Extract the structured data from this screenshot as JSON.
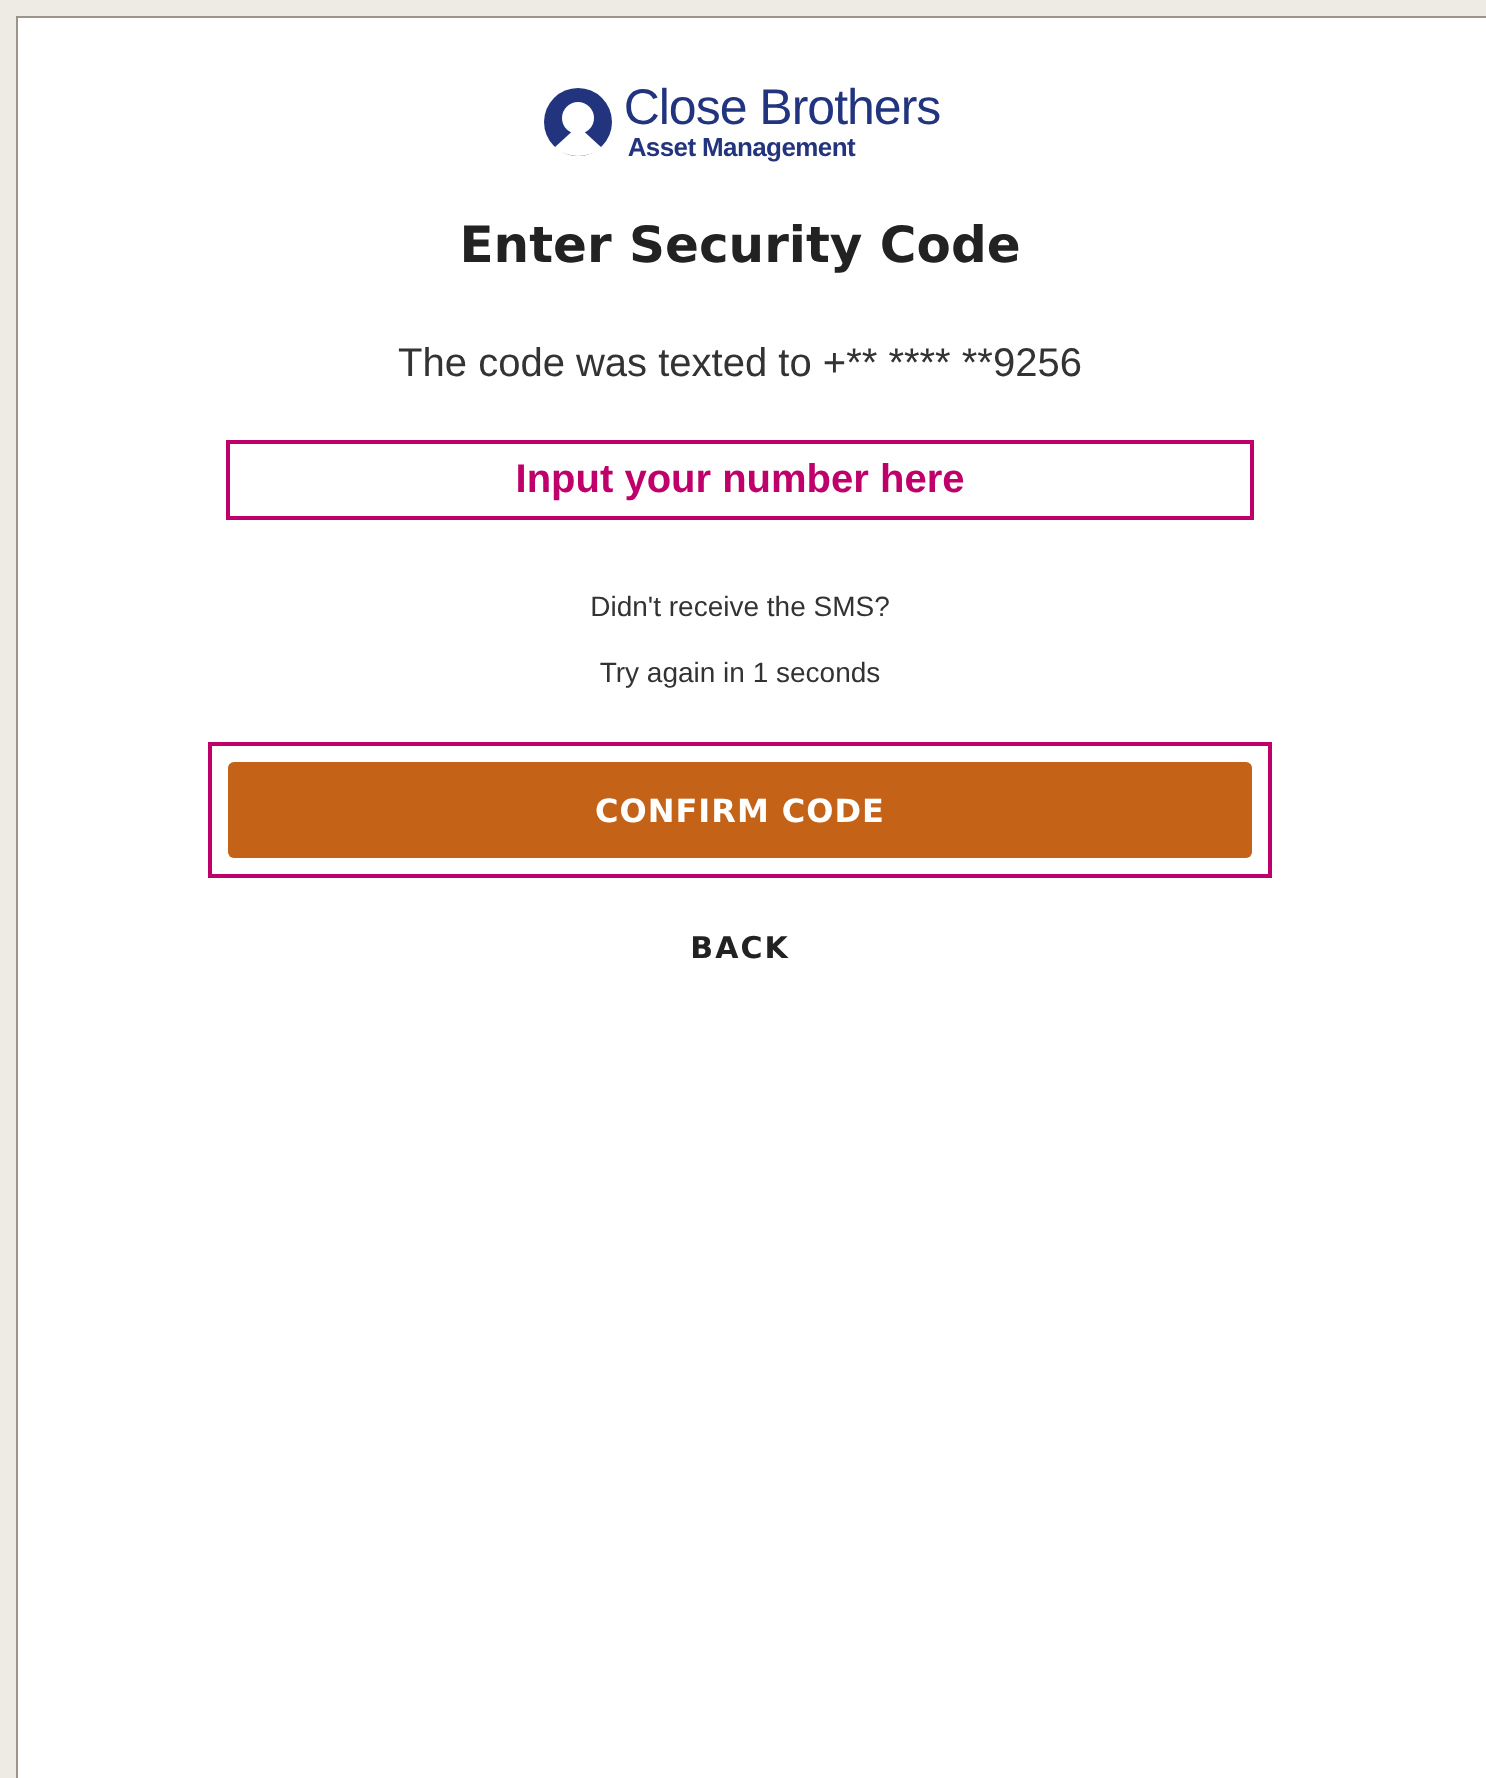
{
  "logo": {
    "name": "Close Brothers",
    "subtitle": "Asset Management"
  },
  "title": "Enter Security Code",
  "message": "The code was texted to +** **** **9256",
  "code_field": {
    "placeholder": "Input your number here"
  },
  "resend": {
    "question": "Didn't receive the SMS?",
    "countdown": "Try again in 1 seconds"
  },
  "confirm_button": {
    "label": "CONFIRM CODE",
    "highlighted": true
  },
  "back_link": "BACK"
}
